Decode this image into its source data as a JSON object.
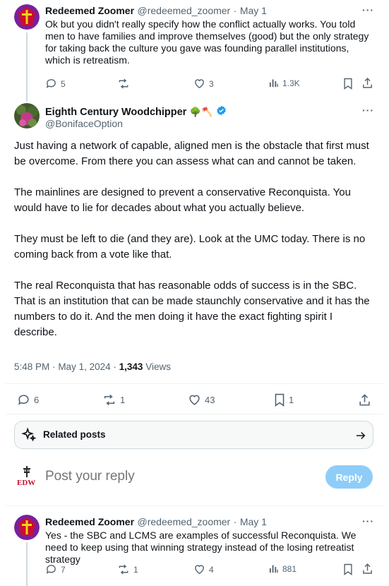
{
  "top_reply": {
    "name": "Redeemed Zoomer",
    "handle": "@redeemed_zoomer",
    "dot": "·",
    "date": "May 1",
    "text": "Ok but you didn't really specify how the conflict actually works. You told men to have families and improve themselves (good) but the only strategy for taking back the culture you gave was founding parallel institutions, which is retreatism.",
    "replies": "5",
    "reposts": "",
    "likes": "3",
    "views": "1.3K"
  },
  "main_post": {
    "name": "Eighth Century Woodchipper",
    "name_emoji": "🌳🪓",
    "handle": "@BonifaceOption",
    "paragraphs": [
      "Just having a network of capable, aligned men is the obstacle that first must be overcome. From there you can assess what can and cannot be taken.",
      "The mainlines are designed to prevent a conservative Reconquista. You would have to lie for decades about what you actually believe.",
      "They must be left to die (and they are). Look at the UMC today. There is no coming back from a vote like that.",
      "The real Reconquista that has reasonable odds of success is in the SBC. That is an institution that can be made staunchly conservative and it has the numbers to do it. And the men doing it have the exact fighting spirit I describe."
    ],
    "time": "5:48 PM",
    "dot": "·",
    "date": "May 1, 2024",
    "dot2": "·",
    "views_count": "1,343",
    "views_label": "Views",
    "replies": "6",
    "reposts": "1",
    "likes": "43",
    "bookmarks": "1"
  },
  "related": {
    "label": "Related posts"
  },
  "composer": {
    "avatar_text": "EDW",
    "placeholder": "Post your reply",
    "button": "Reply"
  },
  "bottom_reply": {
    "name": "Redeemed Zoomer",
    "handle": "@redeemed_zoomer",
    "dot": "·",
    "date": "May 1",
    "text": "Yes - the SBC and LCMS are examples of successful Reconquista. We need to keep using that winning strategy instead of the losing retreatist strategy",
    "replies": "7",
    "reposts": "1",
    "likes": "4",
    "views": "881"
  },
  "colors": {
    "accent": "#1d9bf0",
    "muted": "#536471",
    "reply_button": "#8ecdf8",
    "avatar_red": "#c8102e",
    "avatar_purple": "#7a1f9c"
  },
  "icons": {
    "more": "more-horizontal-icon",
    "reply": "reply-icon",
    "repost": "repost-icon",
    "like": "heart-icon",
    "views": "views-icon",
    "bookmark": "bookmark-icon",
    "share": "share-icon",
    "related": "sparkle-icon",
    "arrow": "arrow-right-icon",
    "verified": "verified-badge-icon"
  }
}
